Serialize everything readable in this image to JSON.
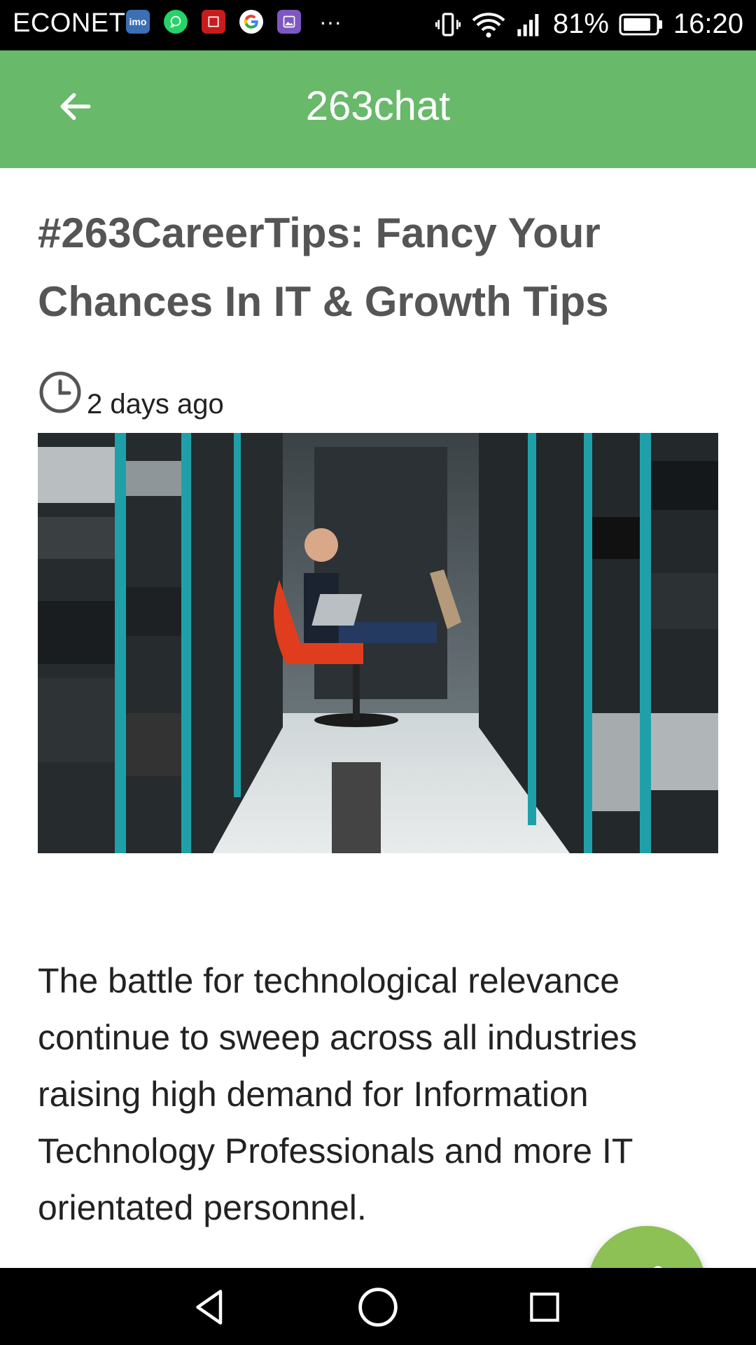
{
  "status_bar": {
    "carrier": "ECONET",
    "battery": "81%",
    "time": "16:20",
    "app_icons": [
      "imo-icon",
      "whatsapp-icon",
      "news-icon",
      "google-icon",
      "gallery-icon"
    ],
    "more": "···"
  },
  "appbar": {
    "title": "263chat"
  },
  "article": {
    "title": "#263CareerTips: Fancy Your Chances In IT & Growth Tips",
    "time_ago": "2 days ago",
    "body": "The battle for technological relevance continue to sweep across all industries raising high demand for Information Technology Professionals and more IT orientated personnel."
  },
  "colors": {
    "appbar": "#68b96a",
    "fab": "#8dc055",
    "title_text": "#555555"
  }
}
